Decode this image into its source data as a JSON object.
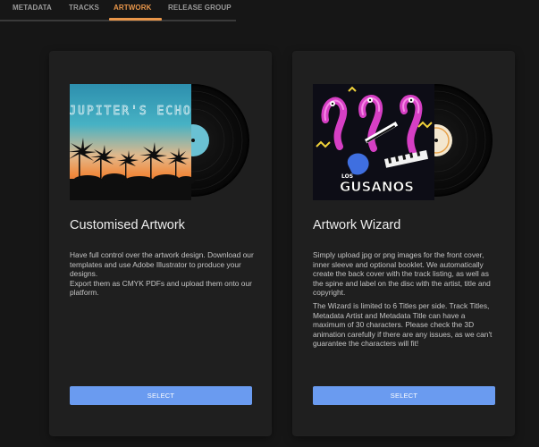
{
  "tabs": [
    {
      "label": "METADATA"
    },
    {
      "label": "TRACKS"
    },
    {
      "label": "ARTWORK"
    },
    {
      "label": "RELEASE GROUP"
    }
  ],
  "active_tab": "ARTWORK",
  "accent_color": "#e8964a",
  "button_color": "#6a9bf0",
  "cards": [
    {
      "title": "Customised Artwork",
      "cover_text": "JUPITER'S ECHO",
      "description": [
        "Have full control over the artwork design. Download our templates and use Adobe Illustrator to produce your designs.",
        "Export them as CMYK PDFs and upload them onto our platform."
      ],
      "button_label": "SELECT"
    },
    {
      "title": "Artwork Wizard",
      "cover_text": "GUSANOS",
      "description": [
        "Simply upload jpg or png images for the front cover, inner sleeve and optional booklet. We automatically create the back cover with the track listing, as well as the spine and label on the disc with the artist, title and copyright.",
        "The Wizard is limited to 6 Titles per side. Track Titles, Metadata Artist and Metadata Title can have a maximum of 30 characters. Please check the 3D animation carefully if there are any issues, as we can't guarantee the characters will fit!"
      ],
      "button_label": "SELECT"
    }
  ]
}
